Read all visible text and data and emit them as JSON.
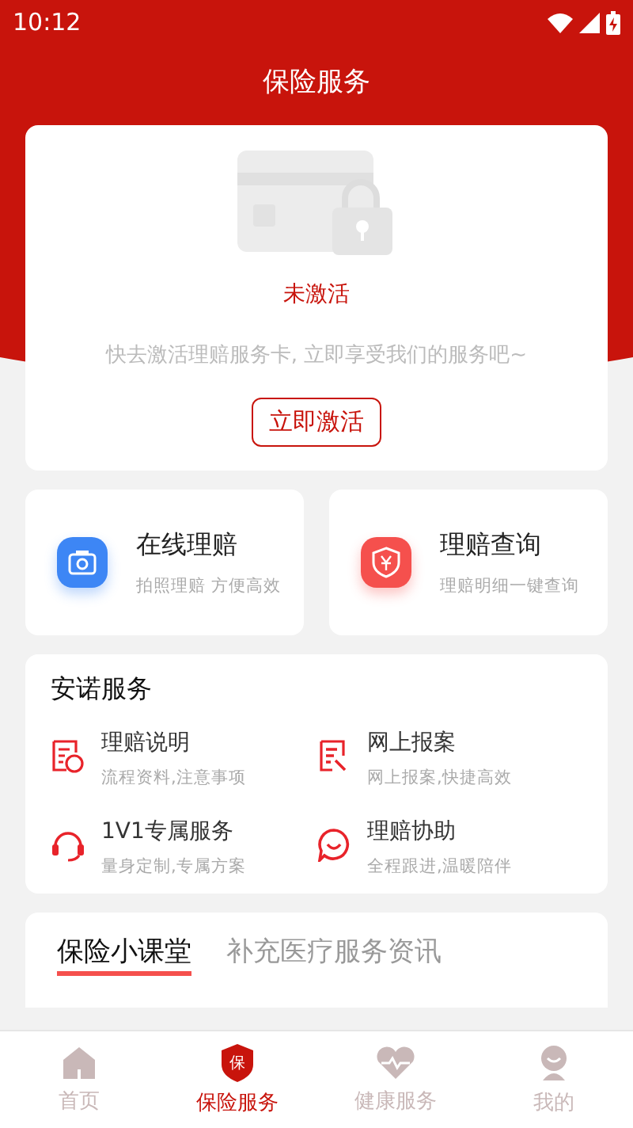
{
  "status_bar": {
    "time": "10:12"
  },
  "header": {
    "title": "保险服务"
  },
  "card_status": {
    "state": "未激活",
    "message": "快去激活理赔服务卡, 立即享受我们的服务吧~",
    "button": "立即激活"
  },
  "quick_actions": [
    {
      "kind": "camera",
      "title": "在线理赔",
      "subtitle": "拍照理赔 方便高效",
      "color": "#3d86f5"
    },
    {
      "kind": "shield",
      "title": "理赔查询",
      "subtitle": "理赔明细一键查询",
      "color": "#f5504d"
    }
  ],
  "services": {
    "title": "安诺服务",
    "items": [
      {
        "kind": "document",
        "title": "理赔说明",
        "subtitle": "流程资料,注意事项"
      },
      {
        "kind": "report",
        "title": "网上报案",
        "subtitle": "网上报案,快捷高效"
      },
      {
        "kind": "headset",
        "title": "1V1专属服务",
        "subtitle": "量身定制,专属方案"
      },
      {
        "kind": "chat",
        "title": "理赔协助",
        "subtitle": "全程跟进,温暖陪伴"
      }
    ]
  },
  "tabs": [
    {
      "label": "保险小课堂",
      "selected": true
    },
    {
      "label": "补充医疗服务资讯",
      "selected": false
    }
  ],
  "bottom_nav": [
    {
      "kind": "home",
      "label": "首页",
      "selected": false
    },
    {
      "kind": "insurance",
      "label": "保险服务",
      "selected": true,
      "badge": "保"
    },
    {
      "kind": "health",
      "label": "健康服务",
      "selected": false
    },
    {
      "kind": "profile",
      "label": "我的",
      "selected": false
    }
  ]
}
